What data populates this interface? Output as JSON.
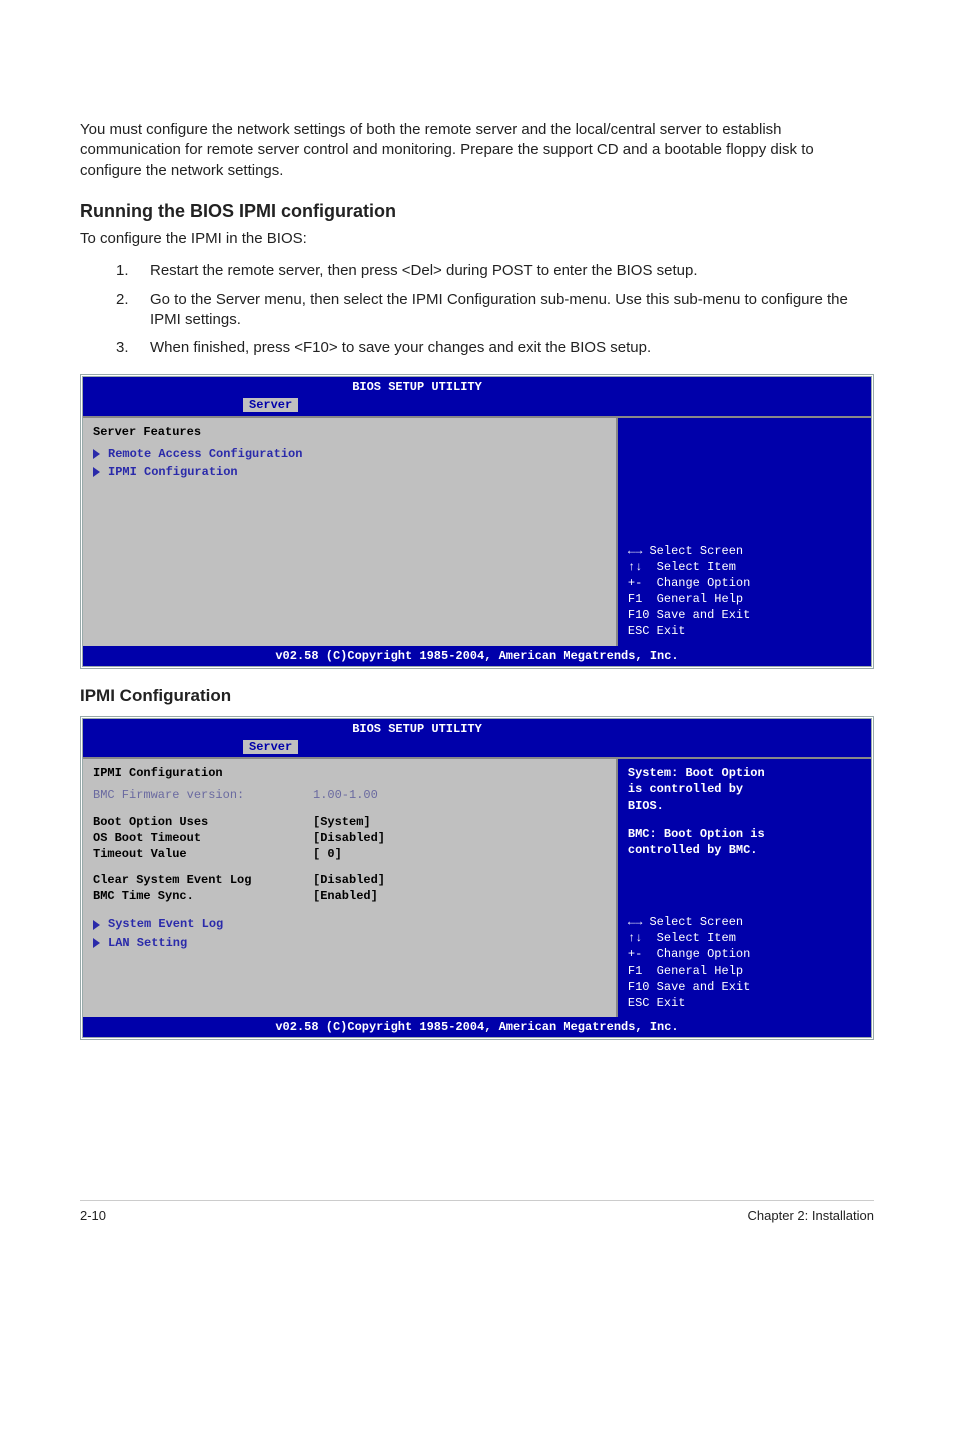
{
  "intro": "You must configure the network settings of both the remote server and the local/central server to establish communication for remote server control and monitoring. Prepare the support CD and a bootable floppy disk to configure the network settings.",
  "section_heading": "Running the BIOS IPMI configuration",
  "lead_text": "To configure the IPMI in the BIOS:",
  "steps": [
    {
      "num": "1.",
      "text": "Restart the remote server, then press <Del> during POST to enter the BIOS setup."
    },
    {
      "num": "2.",
      "text": "Go to the Server menu, then select the IPMI Configuration sub-menu. Use this sub-menu to configure the IPMI settings."
    },
    {
      "num": "3.",
      "text": "When finished, press <F10> to save your changes and exit the BIOS setup."
    }
  ],
  "bios1": {
    "title": "BIOS SETUP UTILITY",
    "tab": "Server",
    "section": "Server Features",
    "items": [
      "Remote Access Configuration",
      "IPMI Configuration"
    ],
    "help": {
      "l1": "←→ Select Screen",
      "l2": "↑↓  Select Item",
      "l3": "+-  Change Option",
      "l4": "F1  General Help",
      "l5": "F10 Save and Exit",
      "l6": "ESC Exit"
    },
    "footer": "v02.58 (C)Copyright 1985-2004, American Megatrends, Inc."
  },
  "ipmi_heading": "IPMI Configuration",
  "bios2": {
    "title": "BIOS SETUP UTILITY",
    "tab": "Server",
    "section": "IPMI Configuration",
    "firmware_label": "BMC Firmware version:",
    "firmware_value": "1.00-1.00",
    "rows": [
      {
        "k": "Boot Option Uses",
        "v": "[System]"
      },
      {
        "k": "OS Boot Timeout",
        "v": "[Disabled]"
      },
      {
        "k": "Timeout Value",
        "v": "[  0]"
      }
    ],
    "rows2": [
      {
        "k": "Clear System Event Log",
        "v": "[Disabled]"
      },
      {
        "k": "BMC Time Sync.",
        "v": "[Enabled]"
      }
    ],
    "subitems": [
      "System Event Log",
      "LAN Setting"
    ],
    "context_help": {
      "l1": "System: Boot Option",
      "l2": "is controlled by",
      "l3": "BIOS.",
      "l4": "",
      "l5": "BMC: Boot Option is",
      "l6": "controlled by BMC."
    },
    "help": {
      "l1": "←→ Select Screen",
      "l2": "↑↓  Select Item",
      "l3": "+-  Change Option",
      "l4": "F1  General Help",
      "l5": "F10 Save and Exit",
      "l6": "ESC Exit"
    },
    "footer": "v02.58 (C)Copyright 1985-2004, American Megatrends, Inc."
  },
  "page_footer": {
    "left": "2-10",
    "right": "Chapter 2: Installation"
  }
}
